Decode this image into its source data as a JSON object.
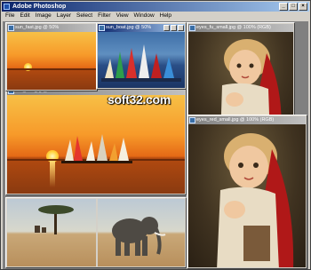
{
  "app": {
    "title": "Adobe Photoshop"
  },
  "menu": [
    "File",
    "Edit",
    "Image",
    "Layer",
    "Select",
    "Filter",
    "View",
    "Window",
    "Help"
  ],
  "documents": {
    "doc1": {
      "title": "sun_fast.jpg @ 50%"
    },
    "doc2": {
      "title": "sun_boat.jpg @ 50%"
    },
    "doc3": {
      "title": "eyes_fu_small.jpg @ 100% (RGB)"
    },
    "doc4": {
      "title": "eyes_red_small.jpg @ 100% (RGB)"
    }
  },
  "watermark": "soft32.com",
  "colors": {
    "title_active": "#0a246a",
    "title_inactive": "#808080",
    "chrome": "#d4d0c8"
  }
}
